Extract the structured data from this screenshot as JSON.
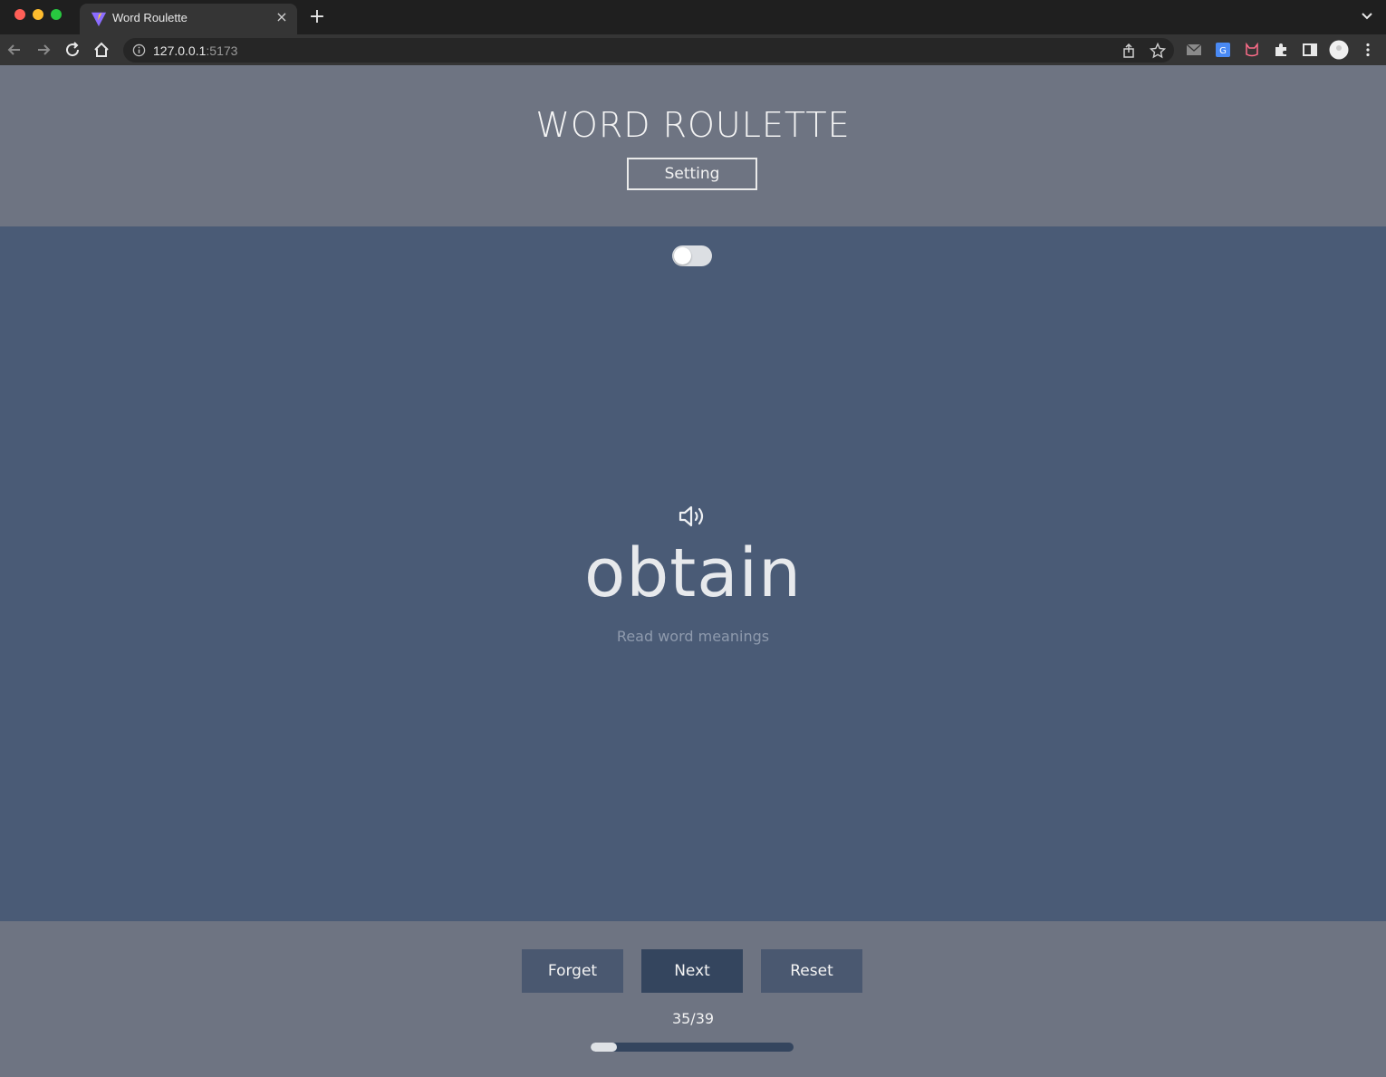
{
  "browser": {
    "tab_title": "Word Roulette",
    "url_host": "127.0.0.1",
    "url_port": ":5173",
    "new_tab_symbol": "+",
    "close_symbol": "×"
  },
  "app": {
    "title": "WORD ROULETTE",
    "setting_label": "Setting"
  },
  "card": {
    "toggle_on": false,
    "word": "obtain",
    "hint": "Read word meanings"
  },
  "controls": {
    "forget_label": "Forget",
    "next_label": "Next",
    "reset_label": "Reset",
    "count": "35/39",
    "progress_fraction": 0.13
  },
  "icons": {
    "favicon": "vite-logo-icon",
    "speaker": "speaker-volume-icon"
  },
  "colors": {
    "header_bg": "#6e7482",
    "main_bg": "#4a5b76",
    "next_btn": "#34455e",
    "side_btn": "#4a5870"
  }
}
